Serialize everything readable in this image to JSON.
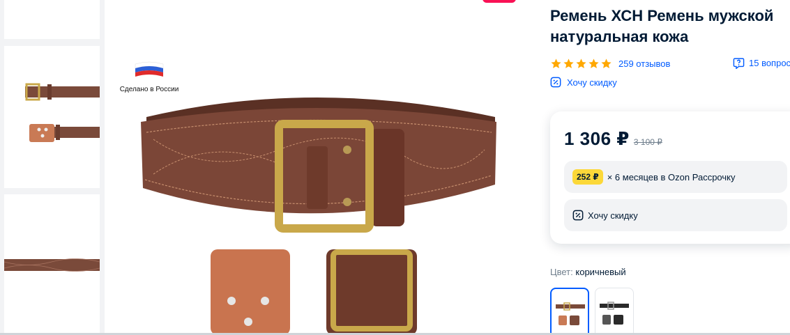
{
  "product": {
    "title_line1": "Ремень ХСН Ремень мужской",
    "title_line2": "натуральная кожа",
    "made_in_label": "Сделано в России"
  },
  "rating": {
    "stars": 5,
    "reviews_label": "259 отзывов",
    "questions_label": "15 вопрос"
  },
  "discount_link_label": "Хочу скидку",
  "price": {
    "current": "1 306 ₽",
    "old": "3 100 ₽",
    "installment_amount": "252 ₽",
    "installment_text": "× 6 месяцев в Ozon Рассрочку",
    "discount_button_label": "Хочу скидку"
  },
  "color": {
    "label": "Цвет:",
    "value": "коричневый"
  },
  "icons": {
    "star": "star-icon",
    "question": "question-icon",
    "discount": "discount-tag-icon"
  },
  "colors": {
    "link": "#005bff",
    "star": "#ffa800",
    "installment_pill": "#fcd839",
    "text": "#001a34",
    "muted": "#707f8d",
    "sale_badge": "#f91155"
  }
}
